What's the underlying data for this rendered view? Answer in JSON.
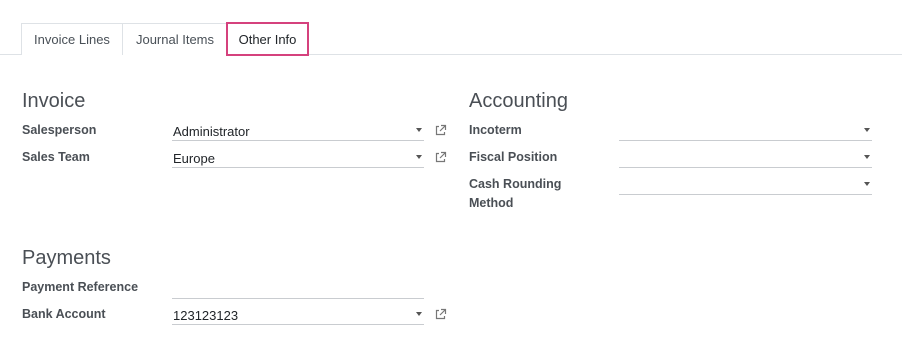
{
  "tabs": [
    {
      "label": "Invoice Lines"
    },
    {
      "label": "Journal Items"
    },
    {
      "label": "Other Info"
    }
  ],
  "invoice": {
    "title": "Invoice",
    "salesperson_label": "Salesperson",
    "salesperson_value": "Administrator",
    "sales_team_label": "Sales Team",
    "sales_team_value": "Europe"
  },
  "accounting": {
    "title": "Accounting",
    "incoterm_label": "Incoterm",
    "incoterm_value": "",
    "fiscal_position_label": "Fiscal Position",
    "fiscal_position_value": "",
    "cash_rounding_label_line1": "Cash Rounding",
    "cash_rounding_label_line2": "Method",
    "cash_rounding_value": ""
  },
  "payments": {
    "title": "Payments",
    "payment_reference_label": "Payment Reference",
    "payment_reference_value": "",
    "bank_account_label": "Bank Account",
    "bank_account_value": "123123123"
  },
  "colors": {
    "active_tab_border": "#d5417d",
    "border": "#dee2e6"
  },
  "icons": {
    "dropdown": "caret-down-icon",
    "external": "external-link-icon"
  }
}
